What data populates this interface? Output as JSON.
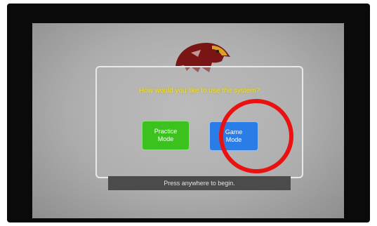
{
  "dialog": {
    "prompt": "How would you like to use the system?",
    "practice_button": {
      "line1": "Practice",
      "line2": "Mode"
    },
    "game_button": {
      "line1": "Game",
      "line2": "Mode"
    }
  },
  "footer": {
    "begin_text": "Press anywhere to begin."
  },
  "colors": {
    "prompt_text": "#f5e21a",
    "practice_button": "#3cc21f",
    "game_button": "#2a7de6",
    "annotation_circle": "#ea1111",
    "logo": "#7a1515"
  },
  "icons": {
    "logo": "hawk-mascot-logo",
    "annotation": "red-circle-highlight"
  }
}
